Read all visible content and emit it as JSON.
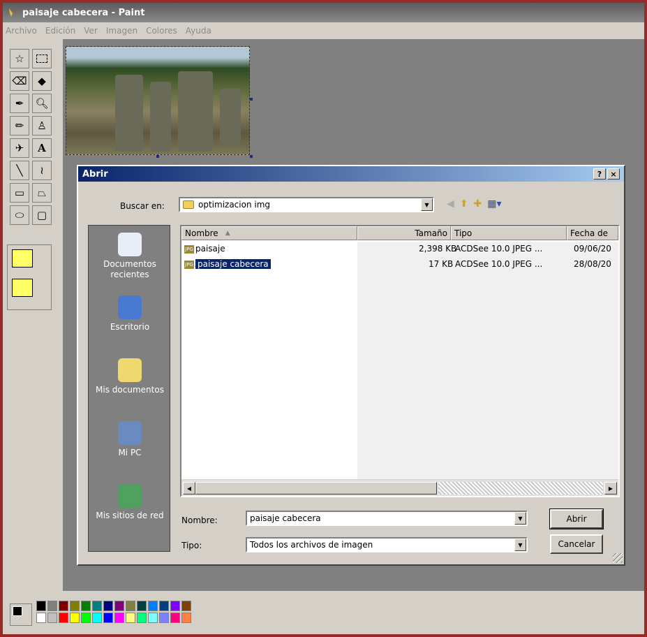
{
  "window": {
    "title": "paisaje cabecera - Paint"
  },
  "menu": [
    "Archivo",
    "Edición",
    "Ver",
    "Imagen",
    "Colores",
    "Ayuda"
  ],
  "toolbox": {
    "tools": [
      "free-select",
      "rect-select",
      "eraser",
      "fill",
      "picker",
      "magnifier",
      "pencil",
      "brush",
      "airbrush",
      "text",
      "line",
      "curve",
      "rectangle",
      "polygon",
      "ellipse",
      "rounded-rect"
    ],
    "text_tool_glyph": "A"
  },
  "dialog": {
    "title": "Abrir",
    "help_label": "?",
    "close_label": "×",
    "lookin_label": "Buscar en:",
    "lookin_value": "optimizacion img",
    "places": [
      {
        "label": "Documentos recientes",
        "icon": "recent-documents-icon"
      },
      {
        "label": "Escritorio",
        "icon": "desktop-icon"
      },
      {
        "label": "Mis documentos",
        "icon": "my-documents-icon"
      },
      {
        "label": "Mi PC",
        "icon": "my-computer-icon"
      },
      {
        "label": "Mis sitios de red",
        "icon": "network-places-icon"
      }
    ],
    "columns": [
      "Nombre",
      "Tamaño",
      "Tipo",
      "Fecha de"
    ],
    "files": [
      {
        "name": "paisaje",
        "size": "2,398 KB",
        "type": "ACDSee 10.0 JPEG ...",
        "date": "09/06/20",
        "selected": false
      },
      {
        "name": "paisaje cabecera",
        "size": "17 KB",
        "type": "ACDSee 10.0 JPEG ...",
        "date": "28/08/20",
        "selected": true
      }
    ],
    "filename_label": "Nombre:",
    "filename_value": "paisaje cabecera",
    "filetype_label": "Tipo:",
    "filetype_value": "Todos los archivos de imagen",
    "open_button": "Abrir",
    "cancel_button": "Cancelar"
  },
  "palette": {
    "top": [
      "#000000",
      "#808080",
      "#800000",
      "#808000",
      "#008000",
      "#008080",
      "#000080",
      "#800080",
      "#808040",
      "#004040",
      "#0080ff",
      "#004080",
      "#8000ff",
      "#804000"
    ],
    "bottom": [
      "#ffffff",
      "#c0c0c0",
      "#ff0000",
      "#ffff00",
      "#00ff00",
      "#00ffff",
      "#0000ff",
      "#ff00ff",
      "#ffff80",
      "#00ff80",
      "#80ffff",
      "#8080ff",
      "#ff0080",
      "#ff8040"
    ]
  }
}
